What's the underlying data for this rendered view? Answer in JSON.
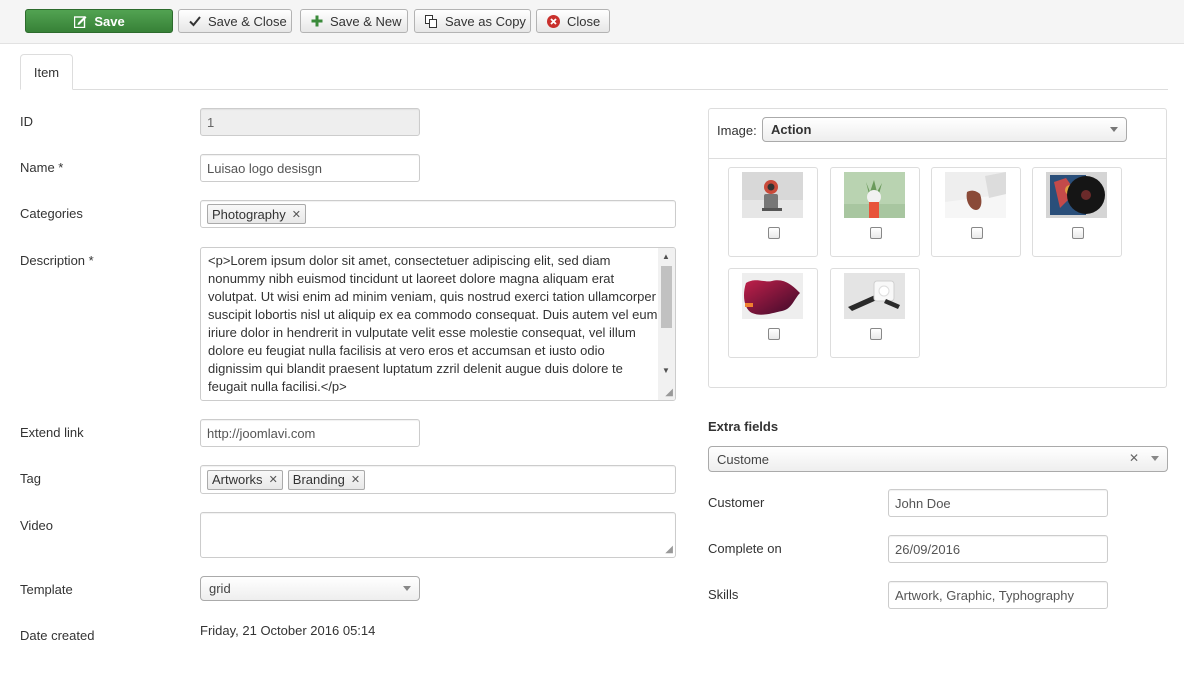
{
  "toolbar": {
    "save_label": "Save",
    "save_close_label": "Save & Close",
    "save_new_label": "Save & New",
    "save_copy_label": "Save as Copy",
    "close_label": "Close"
  },
  "tabs": [
    {
      "label": "Item"
    }
  ],
  "form": {
    "id": {
      "label": "ID",
      "value": "1"
    },
    "name": {
      "label": "Name *",
      "value": "Luisao logo desisgn"
    },
    "categories": {
      "label": "Categories",
      "chips": [
        "Photography"
      ]
    },
    "description": {
      "label": "Description *",
      "value": "<p>Lorem ipsum dolor sit amet, consectetuer adipiscing elit, sed diam nonummy nibh euismod tincidunt ut laoreet dolore magna aliquam erat volutpat. Ut wisi enim ad minim veniam, quis nostrud exerci tation ullamcorper suscipit lobortis nisl ut aliquip ex ea commodo consequat. Duis autem vel eum iriure dolor in hendrerit in vulputate velit esse molestie consequat, vel illum dolore eu feugiat nulla facilisis at vero eros et accumsan et iusto odio dignissim qui blandit praesent luptatum zzril delenit augue duis dolore te feugait nulla facilisi.</p>"
    },
    "extend_link": {
      "label": "Extend link",
      "value": "http://joomlavi.com"
    },
    "tag": {
      "label": "Tag",
      "chips": [
        "Artworks",
        "Branding"
      ]
    },
    "video": {
      "label": "Video",
      "value": ""
    },
    "template": {
      "label": "Template",
      "value": "grid"
    },
    "date_created": {
      "label": "Date created",
      "value": "Friday, 21 October 2016 05:14"
    }
  },
  "image_panel": {
    "label": "Image:",
    "selected": "Action",
    "thumbnails": [
      {
        "name": "thumb-robot"
      },
      {
        "name": "thumb-plant"
      },
      {
        "name": "thumb-vase"
      },
      {
        "name": "thumb-vinyl"
      },
      {
        "name": "thumb-blob"
      },
      {
        "name": "thumb-watch"
      }
    ]
  },
  "extra_fields": {
    "title": "Extra fields",
    "group": "Custome",
    "customer": {
      "label": "Customer",
      "value": "John Doe"
    },
    "complete_on": {
      "label": "Complete on",
      "value": "26/09/2016"
    },
    "skills": {
      "label": "Skills",
      "value": "Artwork, Graphic, Typhography"
    }
  },
  "colors": {
    "save_green": "#3f8f3f",
    "close_red": "#c9302c",
    "new_green": "#3a8a3a"
  }
}
